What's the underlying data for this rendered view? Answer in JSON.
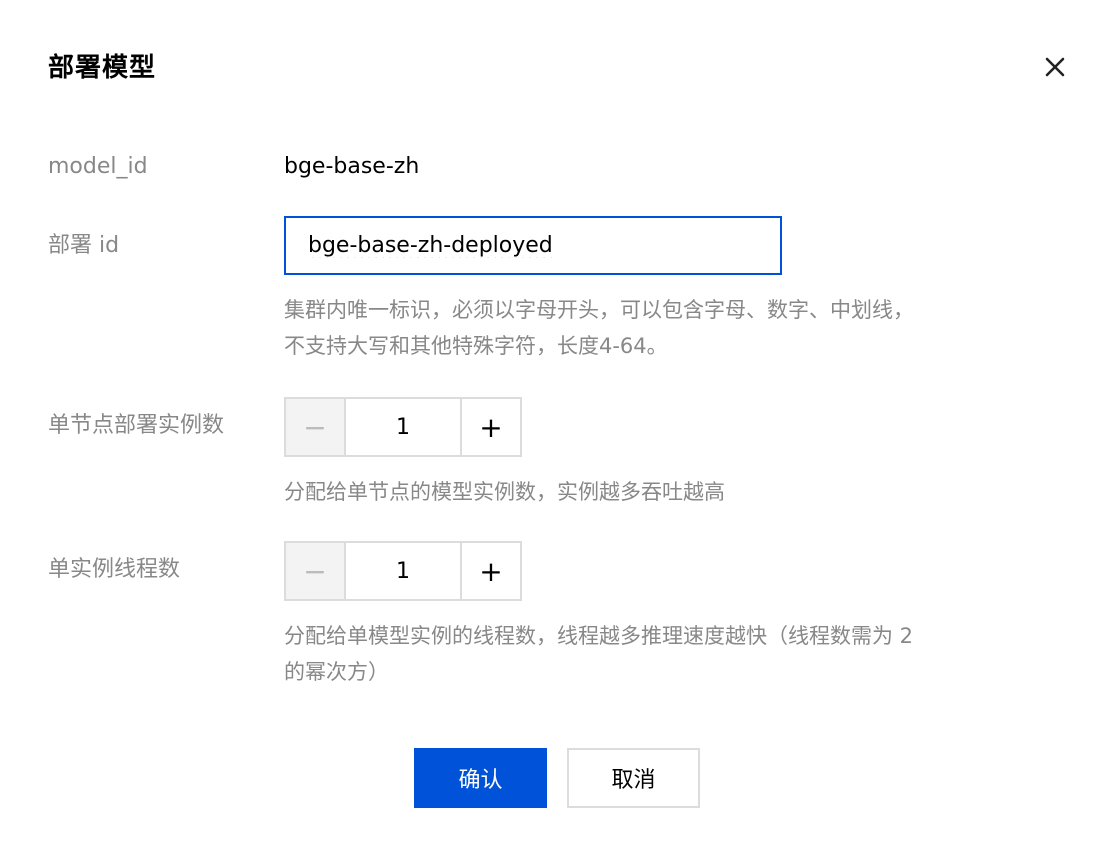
{
  "dialog": {
    "title": "部署模型",
    "close_icon": "close-icon"
  },
  "form": {
    "model_id": {
      "label": "model_id",
      "value": "bge-base-zh"
    },
    "deploy_id": {
      "label": "部署 id",
      "value": "bge-base-zh-deployed",
      "help_line1": "集群内唯一标识，必须以字母开头，可以包含字母、数字、中划线，",
      "help_line2": "不支持大写和其他特殊字符，长度4-64。"
    },
    "instances_per_node": {
      "label": "单节点部署实例数",
      "value": "1",
      "minus": "−",
      "plus": "+",
      "help": "分配给单节点的模型实例数，实例越多吞吐越高"
    },
    "threads_per_instance": {
      "label": "单实例线程数",
      "value": "1",
      "minus": "−",
      "plus": "+",
      "help_line1": "分配给单模型实例的线程数，线程越多推理速度越快（线程数需为 2",
      "help_line2": "的幂次方）"
    }
  },
  "actions": {
    "confirm_label": "确认",
    "cancel_label": "取消"
  },
  "colors": {
    "primary": "#0052d9",
    "label": "#888888",
    "border": "#dcdcdc"
  }
}
